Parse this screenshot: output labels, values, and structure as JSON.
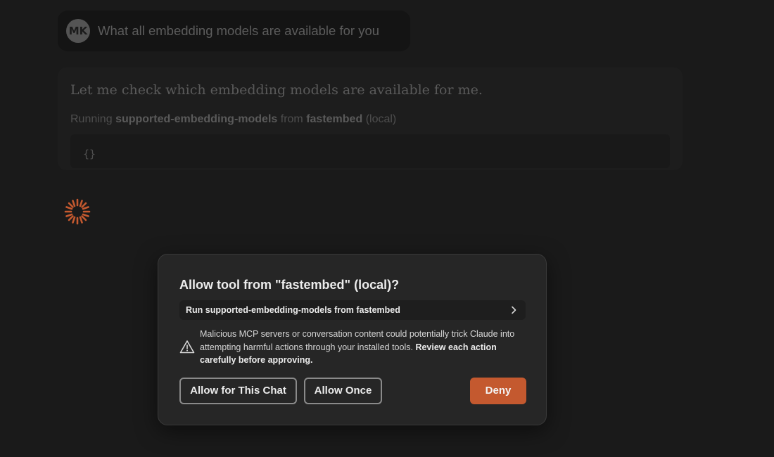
{
  "colors": {
    "background": "#1a1a1a",
    "dialog": "#262626",
    "accent": "#c4592f",
    "spinner": "#c4592f"
  },
  "user_message": {
    "avatar_initials": "MK",
    "text": "What all embedding models are available for you"
  },
  "assistant": {
    "text": "Let me check which embedding models are available for me.",
    "running_prefix": "Running",
    "tool_name": "supported-embedding-models",
    "from_word": "from",
    "server_name": "fastembed",
    "server_scope": "(local)",
    "code": "{}"
  },
  "dialog": {
    "title": "Allow tool from \"fastembed\" (local)?",
    "tool_row_label": "Run supported-embedding-models from fastembed",
    "warning_text": "Malicious MCP servers or conversation content could potentially trick Claude into attempting harmful actions through your installed tools.",
    "warning_emphasis": "Review each action carefully before approving.",
    "buttons": {
      "allow_chat": "Allow for This Chat",
      "allow_once": "Allow Once",
      "deny": "Deny"
    }
  },
  "icons": {
    "spinner": "loading-spinner-icon",
    "chevron": "chevron-right-icon",
    "warning": "warning-triangle-icon"
  }
}
